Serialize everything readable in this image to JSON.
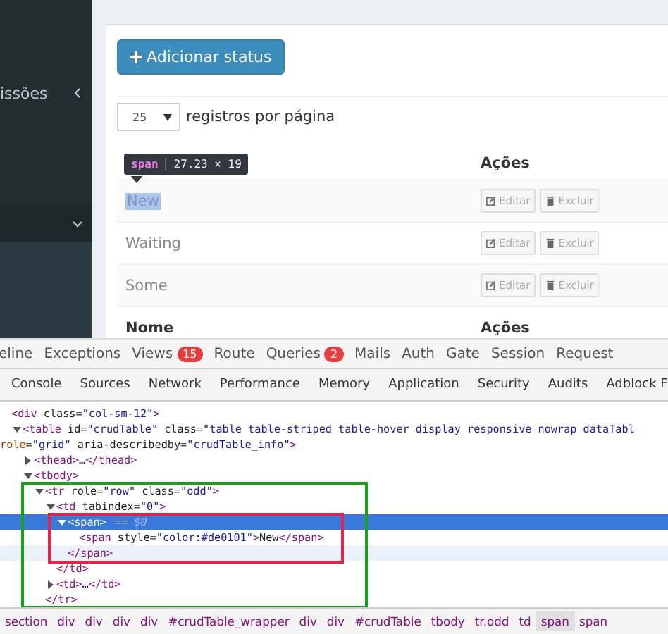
{
  "sidebar": {
    "items": [
      {
        "label": "issões",
        "expanded": false
      },
      {
        "expanded": true
      }
    ]
  },
  "content": {
    "add_button": "Adicionar status",
    "page_size": {
      "value": "25",
      "label": "registros por página"
    },
    "table": {
      "columns": [
        "Ações"
      ],
      "tooltip": {
        "tag": "span",
        "size": "27.23 × 19"
      },
      "rows": [
        {
          "name": "New",
          "highlighted": true,
          "actions": [
            "Editar",
            "Excluir"
          ]
        },
        {
          "name": "Waiting",
          "highlighted": false,
          "actions": [
            "Editar",
            "Excluir"
          ]
        },
        {
          "name": "Some",
          "highlighted": false,
          "actions": [
            "Editar",
            "Excluir"
          ]
        }
      ],
      "footer": [
        "Nome",
        "Ações"
      ]
    }
  },
  "debugbar": {
    "tabs": [
      {
        "label": "eline"
      },
      {
        "label": "Exceptions"
      },
      {
        "label": "Views",
        "badge": "15"
      },
      {
        "label": "Route"
      },
      {
        "label": "Queries",
        "badge": "2"
      },
      {
        "label": "Mails"
      },
      {
        "label": "Auth"
      },
      {
        "label": "Gate"
      },
      {
        "label": "Session"
      },
      {
        "label": "Request"
      }
    ]
  },
  "devtools": {
    "tabs": [
      {
        "label": "Console",
        "selected": false
      },
      {
        "label": "Sources",
        "selected": false
      },
      {
        "label": "Network",
        "selected": false
      },
      {
        "label": "Performance",
        "selected": false
      },
      {
        "label": "Memory",
        "selected": false
      },
      {
        "label": "Application",
        "selected": false
      },
      {
        "label": "Security",
        "selected": false
      },
      {
        "label": "Audits",
        "selected": false
      },
      {
        "label": "Adblock F",
        "selected": false
      }
    ],
    "tree": [
      {
        "lines": [
          "<div class=\"col-sm-12\">"
        ],
        "selected": false,
        "children": [
          {
            "lines": [
              "<table id=\"crudTable\" class=\"table table-striped table-hover display responsive nowrap dataTabl",
              "role=\"grid\" aria-describedby=\"crudTable_info\">"
            ],
            "expanded": true,
            "selected": false,
            "children": [
              {
                "lines": [
                  "<thead>…</thead>"
                ],
                "expanded": false,
                "selected": false
              },
              {
                "lines": [
                  "<tbody>"
                ],
                "expanded": true,
                "selected": false,
                "children": [
                  {
                    "lines": [
                      "<tr role=\"row\" class=\"odd\">"
                    ],
                    "expanded": true,
                    "selected": false,
                    "close": "</tr>",
                    "children": [
                      {
                        "lines": [
                          "<td tabindex=\"0\">"
                        ],
                        "expanded": true,
                        "selected": false,
                        "close": "</td>",
                        "children": [
                          {
                            "lines": [
                              "<span>"
                            ],
                            "suffix": "== $0",
                            "expanded": true,
                            "selected": true,
                            "close": "</span>",
                            "close_hovered": true,
                            "children": [
                              {
                                "lines": [
                                  "<span style=\"color:#de0101\">New</span>"
                                ],
                                "selected": false
                              }
                            ]
                          }
                        ]
                      },
                      {
                        "lines": [
                          "<td>…</td>"
                        ],
                        "expanded": false,
                        "selected": false
                      }
                    ]
                  }
                ]
              }
            ]
          }
        ]
      }
    ],
    "breadcrumbs": [
      {
        "label": "section",
        "selected": false
      },
      {
        "label": "div",
        "selected": false
      },
      {
        "label": "div",
        "selected": false
      },
      {
        "label": "div",
        "selected": false
      },
      {
        "label": "div",
        "selected": false
      },
      {
        "label": "#crudTable_wrapper",
        "selected": false
      },
      {
        "label": "div",
        "selected": false
      },
      {
        "label": "div",
        "selected": false
      },
      {
        "label": "#crudTable",
        "selected": false
      },
      {
        "label": "tbody",
        "selected": false
      },
      {
        "label": "tr.odd",
        "selected": false
      },
      {
        "label": "td",
        "selected": false
      },
      {
        "label": "span",
        "selected": true
      },
      {
        "label": "span",
        "selected": false
      }
    ]
  }
}
